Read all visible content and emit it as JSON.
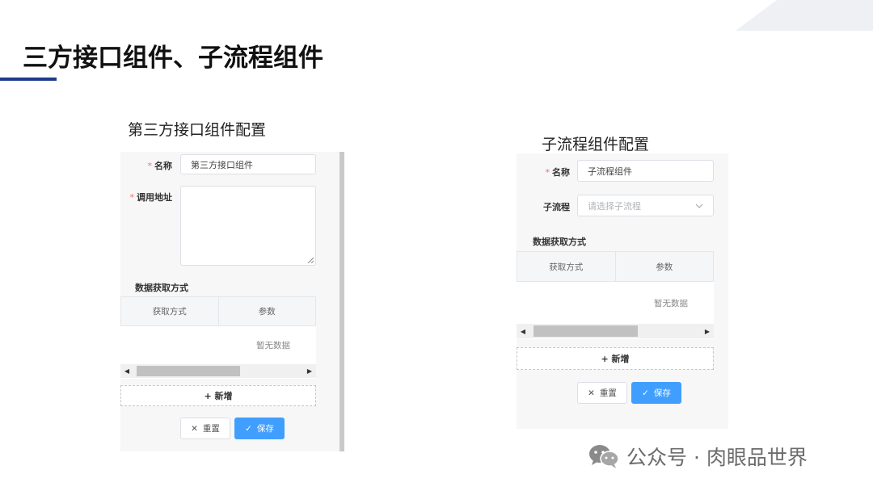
{
  "slide": {
    "title": "三方接口组件、子流程组件"
  },
  "left_panel": {
    "caption": "第三方接口组件配置",
    "name_label": "名称",
    "name_value": "第三方接口组件",
    "address_label": "调用地址",
    "address_value": "",
    "section_title": "数据获取方式",
    "table_headers": [
      "获取方式",
      "参数"
    ],
    "empty_text": "暂无数据",
    "add_label": "+ 新增",
    "reset_label": "重置",
    "save_label": "保存"
  },
  "right_panel": {
    "caption": "子流程组件配置",
    "name_label": "名称",
    "name_value": "子流程组件",
    "subflow_label": "子流程",
    "subflow_placeholder": "请选择子流程",
    "section_title": "数据获取方式",
    "table_headers": [
      "获取方式",
      "参数"
    ],
    "empty_text": "暂无数据",
    "add_label": "+ 新增",
    "reset_label": "重置",
    "save_label": "保存"
  },
  "watermark": {
    "text": "公众号 · 肉眼品世界",
    "icon": "wechat-icon"
  },
  "colors": {
    "title_accent": "#1f3a8a",
    "primary_button": "#409eff",
    "required_mark": "#f56c6c",
    "panel_bg": "#f7f7f8"
  }
}
